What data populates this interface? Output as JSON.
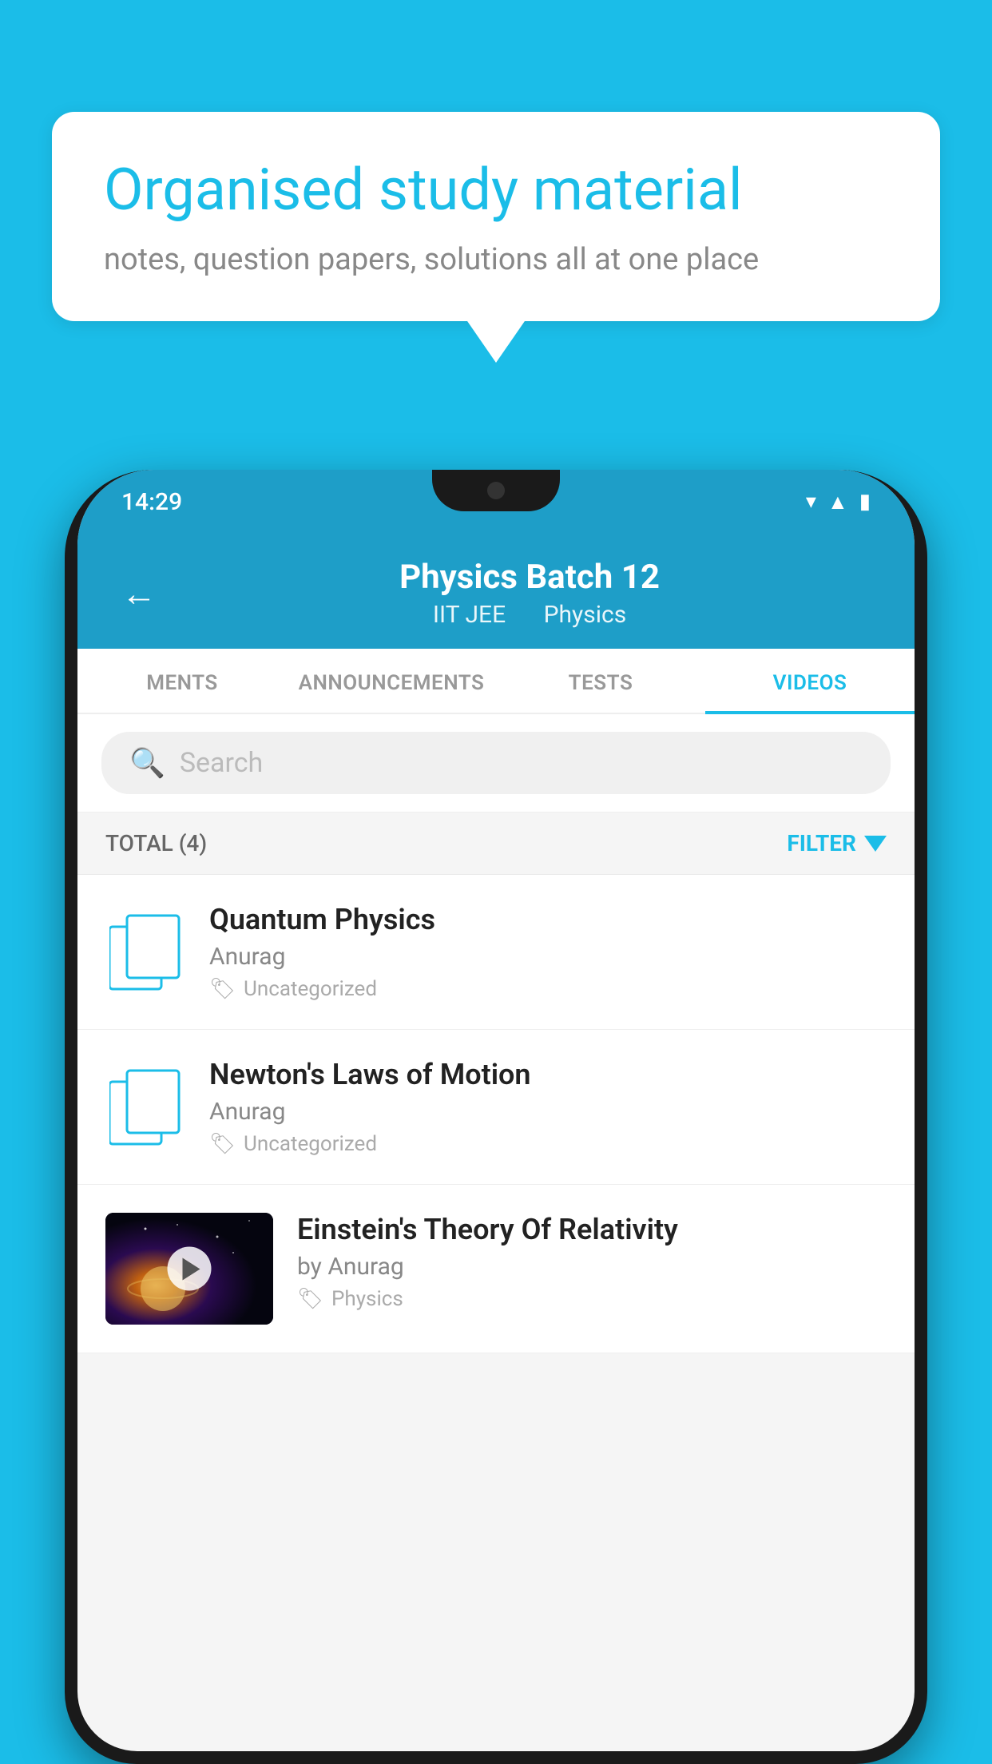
{
  "background_color": "#1bbde8",
  "speech_bubble": {
    "title": "Organised study material",
    "subtitle": "notes, question papers, solutions all at one place"
  },
  "status_bar": {
    "time": "14:29",
    "wifi_icon": "▾",
    "signal_icon": "▲",
    "battery_icon": "▮"
  },
  "app_header": {
    "back_label": "←",
    "title": "Physics Batch 12",
    "subtitle_part1": "IIT JEE",
    "subtitle_part2": "Physics"
  },
  "tabs": [
    {
      "label": "MENTS",
      "active": false
    },
    {
      "label": "ANNOUNCEMENTS",
      "active": false
    },
    {
      "label": "TESTS",
      "active": false
    },
    {
      "label": "VIDEOS",
      "active": true
    }
  ],
  "search": {
    "placeholder": "Search"
  },
  "filter_row": {
    "total_label": "TOTAL (4)",
    "filter_label": "FILTER"
  },
  "videos": [
    {
      "title": "Quantum Physics",
      "author": "Anurag",
      "tag": "Uncategorized",
      "has_thumbnail": false
    },
    {
      "title": "Newton's Laws of Motion",
      "author": "Anurag",
      "tag": "Uncategorized",
      "has_thumbnail": false
    },
    {
      "title": "Einstein's Theory Of Relativity",
      "author": "by Anurag",
      "tag": "Physics",
      "has_thumbnail": true
    }
  ]
}
